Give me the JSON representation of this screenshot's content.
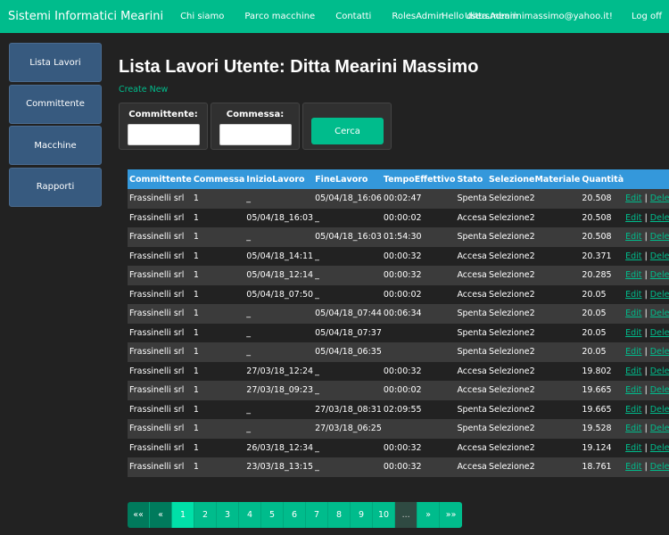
{
  "navbar": {
    "brand": "Sistemi Informatici Mearini",
    "links": [
      "Chi siamo",
      "Parco macchine",
      "Contatti",
      "RolesAdmin",
      "UsersAdmin"
    ],
    "greeting": "Hello ditta.mearinimassimo@yahoo.it!",
    "logoff": "Log off"
  },
  "sidebar": {
    "items": [
      "Lista Lavori",
      "Committente",
      "Macchine",
      "Rapporti"
    ]
  },
  "main": {
    "title": "Lista Lavori Utente: Ditta Mearini Massimo",
    "create_new": "Create New"
  },
  "filters": {
    "committente_label": "Committente:",
    "committente_value": "",
    "commessa_label": "Commessa:",
    "commessa_value": "",
    "cerca_label": "Cerca"
  },
  "table": {
    "headers": [
      "Committente",
      "Commessa",
      "InizioLavoro",
      "FineLavoro",
      "TempoEffettivo",
      "Stato",
      "SelezioneMateriale",
      "Quantità"
    ],
    "edit_label": "Edit",
    "delete_label": "Delete",
    "separator": "|",
    "rows": [
      [
        "Frassinelli srl",
        "1",
        "_",
        "05/04/18_16:06",
        "00:02:47",
        "Spenta",
        "Selezione2",
        "20.508"
      ],
      [
        "Frassinelli srl",
        "1",
        "05/04/18_16:03",
        "_",
        "00:00:02",
        "Accesa",
        "Selezione2",
        "20.508"
      ],
      [
        "Frassinelli srl",
        "1",
        "_",
        "05/04/18_16:03",
        "01:54:30",
        "Spenta",
        "Selezione2",
        "20.508"
      ],
      [
        "Frassinelli srl",
        "1",
        "05/04/18_14:11",
        "_",
        "00:00:32",
        "Accesa",
        "Selezione2",
        "20.371"
      ],
      [
        "Frassinelli srl",
        "1",
        "05/04/18_12:14",
        "_",
        "00:00:32",
        "Accesa",
        "Selezione2",
        "20.285"
      ],
      [
        "Frassinelli srl",
        "1",
        "05/04/18_07:50",
        "_",
        "00:00:02",
        "Accesa",
        "Selezione2",
        "20.05"
      ],
      [
        "Frassinelli srl",
        "1",
        "_",
        "05/04/18_07:44",
        "00:06:34",
        "Spenta",
        "Selezione2",
        "20.05"
      ],
      [
        "Frassinelli srl",
        "1",
        "_",
        "05/04/18_07:37",
        "",
        "Spenta",
        "Selezione2",
        "20.05"
      ],
      [
        "Frassinelli srl",
        "1",
        "_",
        "05/04/18_06:35",
        "",
        "Spenta",
        "Selezione2",
        "20.05"
      ],
      [
        "Frassinelli srl",
        "1",
        "27/03/18_12:24",
        "_",
        "00:00:32",
        "Accesa",
        "Selezione2",
        "19.802"
      ],
      [
        "Frassinelli srl",
        "1",
        "27/03/18_09:23",
        "_",
        "00:00:02",
        "Accesa",
        "Selezione2",
        "19.665"
      ],
      [
        "Frassinelli srl",
        "1",
        "_",
        "27/03/18_08:31",
        "02:09:55",
        "Spenta",
        "Selezione2",
        "19.665"
      ],
      [
        "Frassinelli srl",
        "1",
        "_",
        "27/03/18_06:25",
        "",
        "Spenta",
        "Selezione2",
        "19.528"
      ],
      [
        "Frassinelli srl",
        "1",
        "26/03/18_12:34",
        "_",
        "00:00:32",
        "Accesa",
        "Selezione2",
        "19.124"
      ],
      [
        "Frassinelli srl",
        "1",
        "23/03/18_13:15",
        "_",
        "00:00:32",
        "Accesa",
        "Selezione2",
        "18.761"
      ]
    ]
  },
  "pagination": {
    "first": "««",
    "prev": "«",
    "pages": [
      "1",
      "2",
      "3",
      "4",
      "5",
      "6",
      "7",
      "8",
      "9",
      "10"
    ],
    "current": "1",
    "ellipsis": "...",
    "next": "»",
    "last": "»»"
  },
  "colors": {
    "accent": "#00bc8c",
    "sidebar": "#375a7f",
    "table_header": "#3498db",
    "background": "#222222"
  }
}
